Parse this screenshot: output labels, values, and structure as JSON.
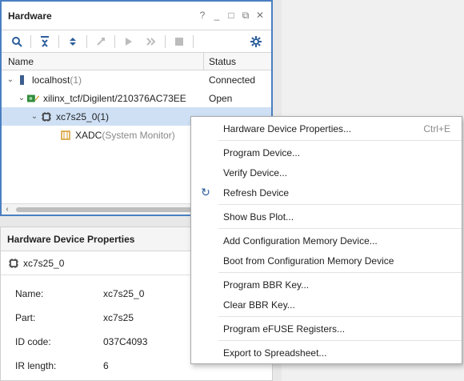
{
  "hardware_panel": {
    "title": "Hardware",
    "header_icons": [
      "?",
      "_",
      "□",
      "⧉",
      "✕"
    ],
    "toolbar": [
      {
        "name": "search-icon",
        "glyph": "⚲"
      },
      {
        "name": "collapse-all-icon",
        "glyph": "⇞"
      },
      {
        "name": "expand-all-icon",
        "glyph": "⇕"
      },
      {
        "name": "auto-connect-icon",
        "glyph": "⚙"
      },
      {
        "name": "run-icon",
        "glyph": "▶"
      },
      {
        "name": "fast-forward-icon",
        "glyph": "»"
      },
      {
        "name": "stop-icon",
        "glyph": "■"
      },
      {
        "name": "settings-icon",
        "glyph": "⚙"
      }
    ],
    "columns": {
      "name": "Name",
      "status": "Status"
    },
    "rows": [
      {
        "label": "localhost",
        "suffix": " (1)",
        "status": "Connected"
      },
      {
        "label": "xilinx_tcf/Digilent/210376AC73EE",
        "suffix": "",
        "status": "Open"
      },
      {
        "label": "xc7s25_0",
        "suffix": " (1)",
        "status": ""
      },
      {
        "label": "XADC",
        "suffix": " (System Monitor)",
        "status": ""
      }
    ]
  },
  "properties_panel": {
    "title": "Hardware Device Properties",
    "device": "xc7s25_0",
    "properties": [
      {
        "key": "Name:",
        "value": "xc7s25_0"
      },
      {
        "key": "Part:",
        "value": "xc7s25"
      },
      {
        "key": "ID code:",
        "value": "037C4093"
      },
      {
        "key": "IR length:",
        "value": "6"
      }
    ]
  },
  "context_menu": {
    "items": [
      {
        "label": "Hardware Device Properties...",
        "shortcut": "Ctrl+E"
      },
      {
        "label": "Program Device...",
        "shortcut": ""
      },
      {
        "label": "Verify Device...",
        "shortcut": ""
      },
      {
        "label": "Refresh Device",
        "shortcut": ""
      },
      {
        "label": "Show Bus Plot...",
        "shortcut": ""
      },
      {
        "label": "Add Configuration Memory Device...",
        "shortcut": ""
      },
      {
        "label": "Boot from Configuration Memory Device",
        "shortcut": ""
      },
      {
        "label": "Program BBR Key...",
        "shortcut": ""
      },
      {
        "label": "Clear BBR Key...",
        "shortcut": ""
      },
      {
        "label": "Program eFUSE Registers...",
        "shortcut": ""
      },
      {
        "label": "Export to Spreadsheet...",
        "shortcut": ""
      }
    ],
    "refresh_icon": "↻"
  }
}
